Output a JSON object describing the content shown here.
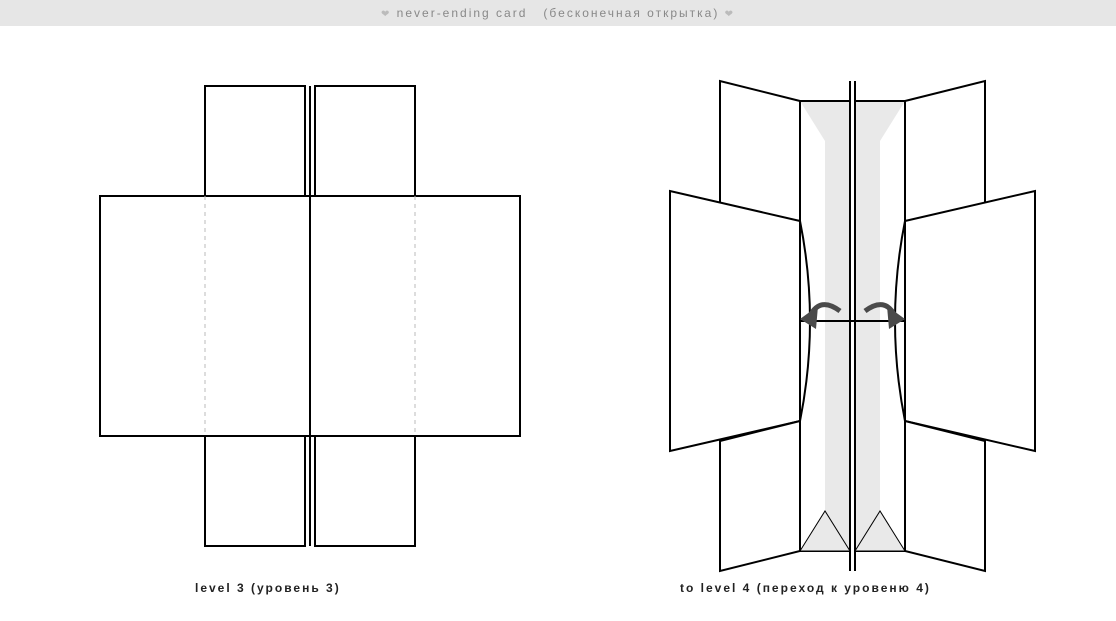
{
  "header": {
    "title_en": "never-ending card",
    "title_ru": "(бесконечная открытка)",
    "heart": "❤"
  },
  "captions": {
    "left": "level 3 (уровень 3)",
    "right": "to level 4 (переход к уровеню 4)"
  }
}
